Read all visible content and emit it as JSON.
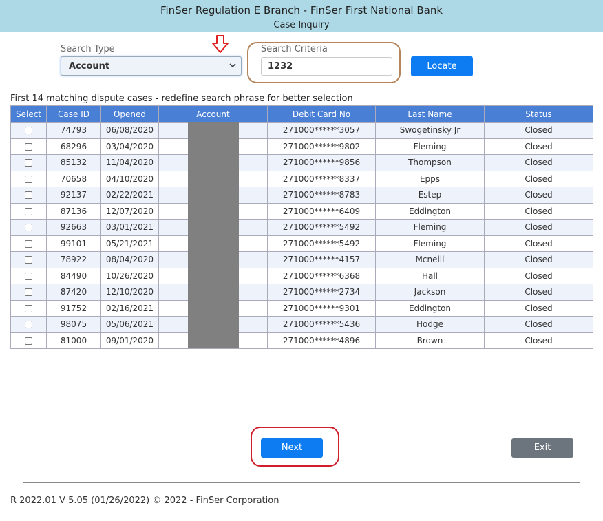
{
  "header": {
    "title": "FinSer Regulation E Branch - FinSer First National Bank",
    "subtitle": "Case Inquiry"
  },
  "search": {
    "type_label": "Search Type",
    "type_value": "Account",
    "criteria_label": "Search Criteria",
    "criteria_value": "1232",
    "locate_label": "Locate"
  },
  "results": {
    "caption": "First 14 matching dispute cases - redefine search phrase for better selection",
    "columns": [
      "Select",
      "Case ID",
      "Opened",
      "Account",
      "Debit Card No",
      "Last Name",
      "Status"
    ],
    "rows": [
      {
        "case_id": "74793",
        "opened": "06/08/2020",
        "account": "",
        "card": "271000******3057",
        "last_name": "Swogetinsky Jr",
        "status": "Closed"
      },
      {
        "case_id": "68296",
        "opened": "03/04/2020",
        "account": "",
        "card": "271000******9802",
        "last_name": "Fleming",
        "status": "Closed"
      },
      {
        "case_id": "85132",
        "opened": "11/04/2020",
        "account": "",
        "card": "271000******9856",
        "last_name": "Thompson",
        "status": "Closed"
      },
      {
        "case_id": "70658",
        "opened": "04/10/2020",
        "account": "",
        "card": "271000******8337",
        "last_name": "Epps",
        "status": "Closed"
      },
      {
        "case_id": "92137",
        "opened": "02/22/2021",
        "account": "",
        "card": "271000******8783",
        "last_name": "Estep",
        "status": "Closed"
      },
      {
        "case_id": "87136",
        "opened": "12/07/2020",
        "account": "",
        "card": "271000******6409",
        "last_name": "Eddington",
        "status": "Closed"
      },
      {
        "case_id": "92663",
        "opened": "03/01/2021",
        "account": "",
        "card": "271000******5492",
        "last_name": "Fleming",
        "status": "Closed"
      },
      {
        "case_id": "99101",
        "opened": "05/21/2021",
        "account": "",
        "card": "271000******5492",
        "last_name": "Fleming",
        "status": "Closed"
      },
      {
        "case_id": "78922",
        "opened": "08/04/2020",
        "account": "",
        "card": "271000******4157",
        "last_name": "Mcneill",
        "status": "Closed"
      },
      {
        "case_id": "84490",
        "opened": "10/26/2020",
        "account": "",
        "card": "271000******6368",
        "last_name": "Hall",
        "status": "Closed"
      },
      {
        "case_id": "87420",
        "opened": "12/10/2020",
        "account": "",
        "card": "271000******2734",
        "last_name": "Jackson",
        "status": "Closed"
      },
      {
        "case_id": "91752",
        "opened": "02/16/2021",
        "account": "",
        "card": "271000******9301",
        "last_name": "Eddington",
        "status": "Closed"
      },
      {
        "case_id": "98075",
        "opened": "05/06/2021",
        "account": "",
        "card": "271000******5436",
        "last_name": "Hodge",
        "status": "Closed"
      },
      {
        "case_id": "81000",
        "opened": "09/01/2020",
        "account": "",
        "card": "271000******4896",
        "last_name": "Brown",
        "status": "Closed"
      }
    ]
  },
  "actions": {
    "next_label": "Next",
    "exit_label": "Exit"
  },
  "footer": {
    "text": "R 2022.01 V 5.05 (01/26/2022) © 2022 - FinSer Corporation"
  },
  "colors": {
    "header_bg": "#add8e6",
    "table_header_bg": "#4a7fd6",
    "primary_button": "#0d7cf2",
    "exit_button": "#6c757d",
    "criteria_highlight": "#b5845a",
    "next_highlight": "#d01f2a",
    "arrow": "#e02020",
    "redaction": "#808080"
  },
  "icons": {
    "type_dropdown": "chevron-down-icon",
    "annotation": "down-arrow-icon"
  }
}
